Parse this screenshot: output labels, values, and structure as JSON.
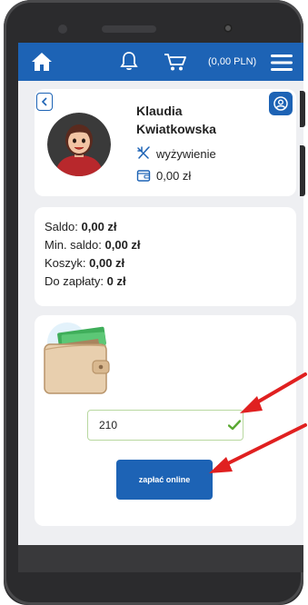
{
  "header": {
    "cart_total": "(0,00 PLN)",
    "icons": [
      "home-icon",
      "bell-icon",
      "cart-icon",
      "menu-icon"
    ]
  },
  "profile": {
    "first_name": "Klaudia",
    "last_name": "Kwiatkowska",
    "diet_label": "wyżywienie",
    "balance": "0,00 zł"
  },
  "summary": {
    "saldo_label": "Saldo:",
    "saldo_value": "0,00 zł",
    "min_saldo_label": "Min. saldo:",
    "min_saldo_value": "0,00 zł",
    "koszyk_label": "Koszyk:",
    "koszyk_value": "0,00 zł",
    "do_zaplaty_label": "Do zapłaty:",
    "do_zaplaty_value": "0 zł"
  },
  "payment": {
    "amount_value": "210",
    "pay_button_label": "zapłać online"
  },
  "colors": {
    "brand_blue": "#1d63b5",
    "screen_bg": "#eeeff2",
    "valid_green": "#5aa832",
    "annotation_red": "#e02020"
  }
}
